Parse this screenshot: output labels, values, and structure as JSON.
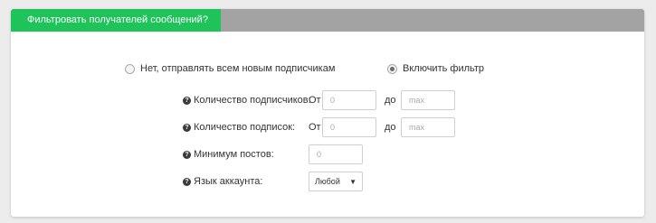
{
  "header": {
    "title": "Фильтровать получателей сообщений?"
  },
  "mode": {
    "option_all": "Нет, отправлять всем новым подписчикам",
    "option_filter": "Включить фильтр",
    "selected": "filter"
  },
  "filters": {
    "subscribers": {
      "label": "Количество подписчиков:",
      "from_label": "От",
      "to_label": "до",
      "from_placeholder": "0",
      "to_placeholder": "max"
    },
    "subscriptions": {
      "label": "Количество подписок:",
      "from_label": "От",
      "to_label": "до",
      "from_placeholder": "0",
      "to_placeholder": "max"
    },
    "min_posts": {
      "label": "Минимум постов:",
      "placeholder": "0"
    },
    "language": {
      "label": "Язык аккаунта:",
      "value": "Любой"
    }
  },
  "icons": {
    "help": "question-circle-icon",
    "dropdown": "chevron-down-icon"
  },
  "colors": {
    "accent": "#1ec45a",
    "header_bar": "#a3a3a3"
  }
}
